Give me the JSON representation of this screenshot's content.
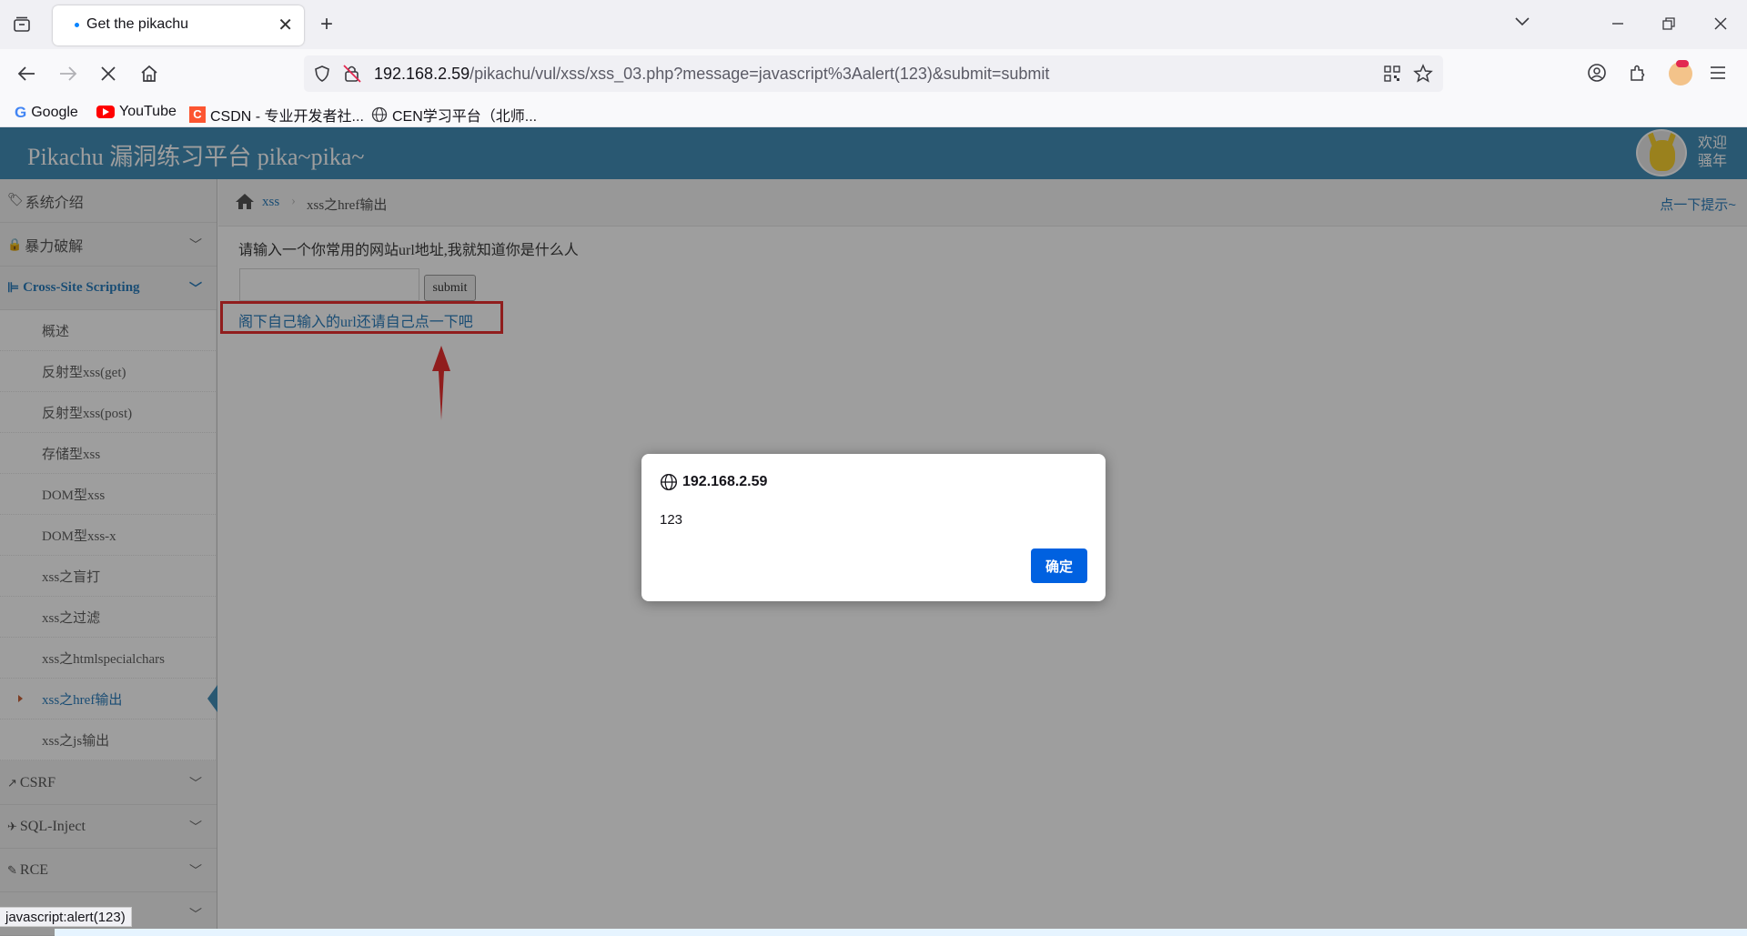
{
  "browser": {
    "tab_title": "Get the pikachu",
    "url_host": "192.168.2.59",
    "url_path": "/pikachu/vul/xss/xss_03.php?message=javascript%3Aalert(123)&submit=submit",
    "bookmarks": [
      "Google",
      "YouTube",
      "CSDN - 专业开发者社...",
      "CEN学习平台（北师..."
    ],
    "status_text": "javascript:alert(123)"
  },
  "site": {
    "brand": "Pikachu 漏洞练习平台 pika~pika~",
    "welcome_line1": "欢迎",
    "welcome_line2": "骚年"
  },
  "sidebar": {
    "top_items": [
      {
        "label": "系统介绍",
        "icon": "tags-icon"
      },
      {
        "label": "暴力破解",
        "icon": "lock-icon"
      },
      {
        "label": "Cross-Site Scripting",
        "icon": "sitemap-icon"
      }
    ],
    "xss_sub_items": [
      "概述",
      "反射型xss(get)",
      "反射型xss(post)",
      "存储型xss",
      "DOM型xss",
      "DOM型xss-x",
      "xss之盲打",
      "xss之过滤",
      "xss之htmlspecialchars",
      "xss之href输出",
      "xss之js输出"
    ],
    "active_sub_index": 9,
    "bottom_items": [
      {
        "label": "CSRF",
        "icon": "share-icon"
      },
      {
        "label": "SQL-Inject",
        "icon": "plane-icon"
      },
      {
        "label": "RCE",
        "icon": "pencil-icon"
      }
    ]
  },
  "content": {
    "breadcrumb_section": "xss",
    "breadcrumb_page": "xss之href输出",
    "hint_link": "点一下提示~",
    "prompt": "请输入一个你常用的网站url地址,我就知道你是什么人",
    "input_value": "",
    "submit_label": "submit",
    "result_text": "阁下自己输入的url还请自己点一下吧"
  },
  "dialog": {
    "origin": "192.168.2.59",
    "message": "123",
    "ok_label": "确定"
  },
  "colors": {
    "banner": "#438eb9",
    "active_text": "#2b7dbc",
    "annotation_red": "#e83030",
    "dialog_button": "#0061e0"
  }
}
